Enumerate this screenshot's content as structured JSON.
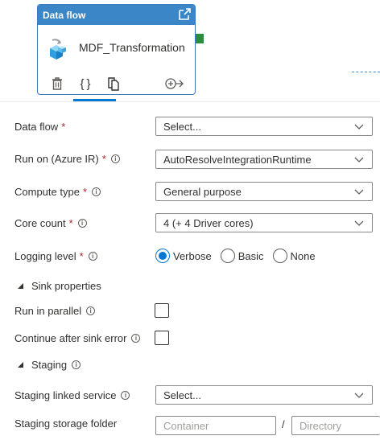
{
  "card": {
    "header": "Data flow",
    "name": "MDF_Transformation"
  },
  "form": {
    "data_flow": {
      "label": "Data flow",
      "required": "*",
      "value": "Select..."
    },
    "run_on": {
      "label": "Run on (Azure IR)",
      "required": "*",
      "value": "AutoResolveIntegrationRuntime"
    },
    "compute_type": {
      "label": "Compute type",
      "required": "*",
      "value": "General purpose"
    },
    "core_count": {
      "label": "Core count",
      "required": "*",
      "value": "4 (+ 4 Driver cores)"
    },
    "logging_level": {
      "label": "Logging level",
      "required": "*",
      "options": [
        "Verbose",
        "Basic",
        "None"
      ],
      "selected": "Verbose"
    },
    "sink_properties": {
      "label": "Sink properties"
    },
    "run_in_parallel": {
      "label": "Run in parallel",
      "checked": false
    },
    "continue_after_error": {
      "label": "Continue after sink error",
      "checked": false
    },
    "staging": {
      "label": "Staging"
    },
    "staging_linked_service": {
      "label": "Staging linked service",
      "value": "Select..."
    },
    "staging_storage_folder": {
      "label": "Staging storage folder",
      "container_placeholder": "Container",
      "separator": "/",
      "directory_placeholder": "Directory"
    }
  },
  "colors": {
    "accent": "#0078d4",
    "card_header": "#3b86c6",
    "connector": "#2e8b3e",
    "required": "#a4262c"
  },
  "icons": {
    "open": "open-in-new-icon",
    "dataflow": "dataflow-icon",
    "delete": "trash-icon",
    "code": "code-braces-icon",
    "copy": "copy-icon",
    "add_output": "add-output-icon",
    "info": "info-icon",
    "chevron": "chevron-down-icon",
    "collapse": "collapse-triangle-icon"
  }
}
